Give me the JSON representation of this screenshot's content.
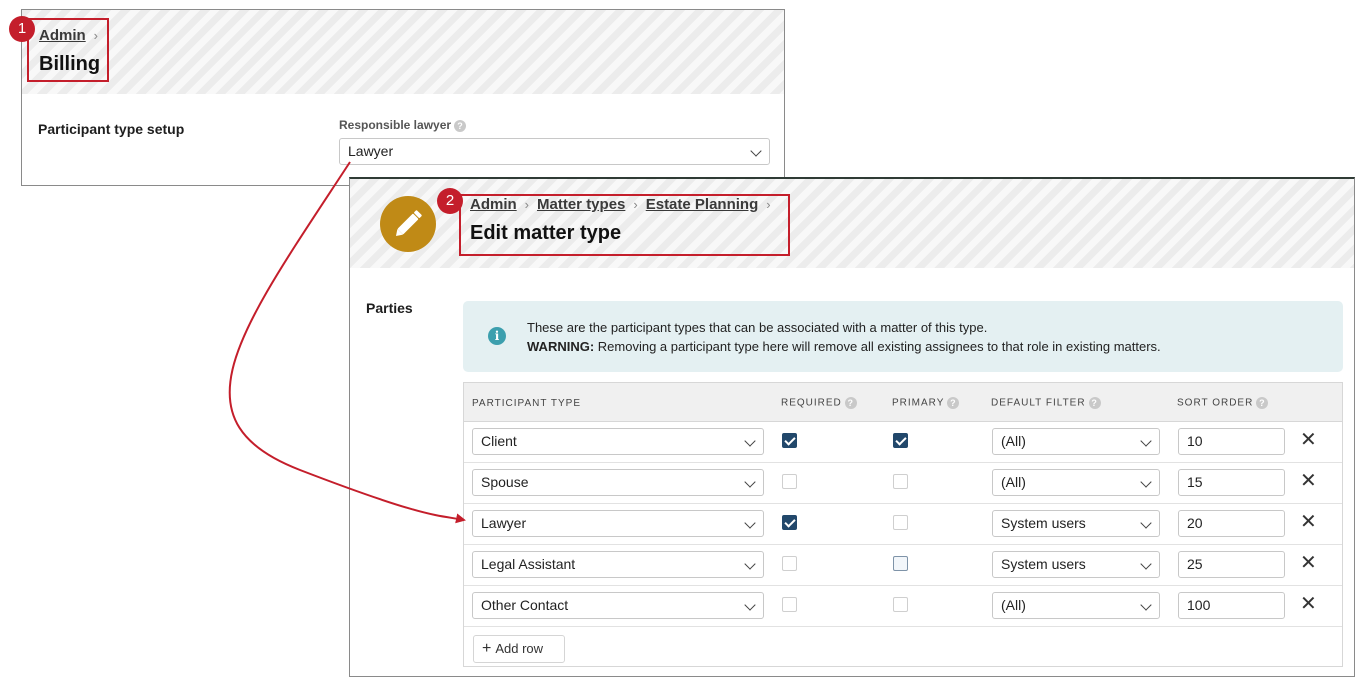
{
  "callouts": [
    "1",
    "2"
  ],
  "billing": {
    "breadcrumb": [
      "Admin"
    ],
    "title": "Billing",
    "section_label": "Participant type setup",
    "field_label": "Responsible lawyer",
    "field_value": "Lawyer"
  },
  "matter": {
    "breadcrumb": [
      "Admin",
      "Matter types",
      "Estate Planning"
    ],
    "title": "Edit matter type",
    "section_label": "Parties",
    "info_line1": "These are the participant types that can be associated with a matter of this type.",
    "info_warning_label": "WARNING:",
    "info_warning_text": " Removing a participant type here will remove all existing assignees to that role in existing matters.",
    "columns": [
      "PARTICIPANT TYPE",
      "REQUIRED",
      "PRIMARY",
      "DEFAULT FILTER",
      "SORT ORDER"
    ],
    "rows": [
      {
        "participant_type": "Client",
        "required": true,
        "primary": true,
        "default_filter": "(All)",
        "sort_order": "10"
      },
      {
        "participant_type": "Spouse",
        "required": false,
        "primary": false,
        "default_filter": "(All)",
        "sort_order": "15"
      },
      {
        "participant_type": "Lawyer",
        "required": true,
        "primary": false,
        "default_filter": "System users",
        "sort_order": "20"
      },
      {
        "participant_type": "Legal Assistant",
        "required": false,
        "primary": false,
        "default_filter": "System users",
        "sort_order": "25"
      },
      {
        "participant_type": "Other Contact",
        "required": false,
        "primary": false,
        "default_filter": "(All)",
        "sort_order": "100"
      }
    ],
    "add_row_label": "Add row",
    "add_row_icon": "+",
    "delete_icon": "✕"
  },
  "icons": {
    "avatar": "pencil-icon",
    "info": "info-icon",
    "help": "help-icon"
  },
  "colors": {
    "callout": "#c41e2b",
    "checkbox_on": "#22486b",
    "avatar": "#c08a16",
    "info_bg": "#e4f0f2",
    "info_icon": "#3c9fae"
  }
}
